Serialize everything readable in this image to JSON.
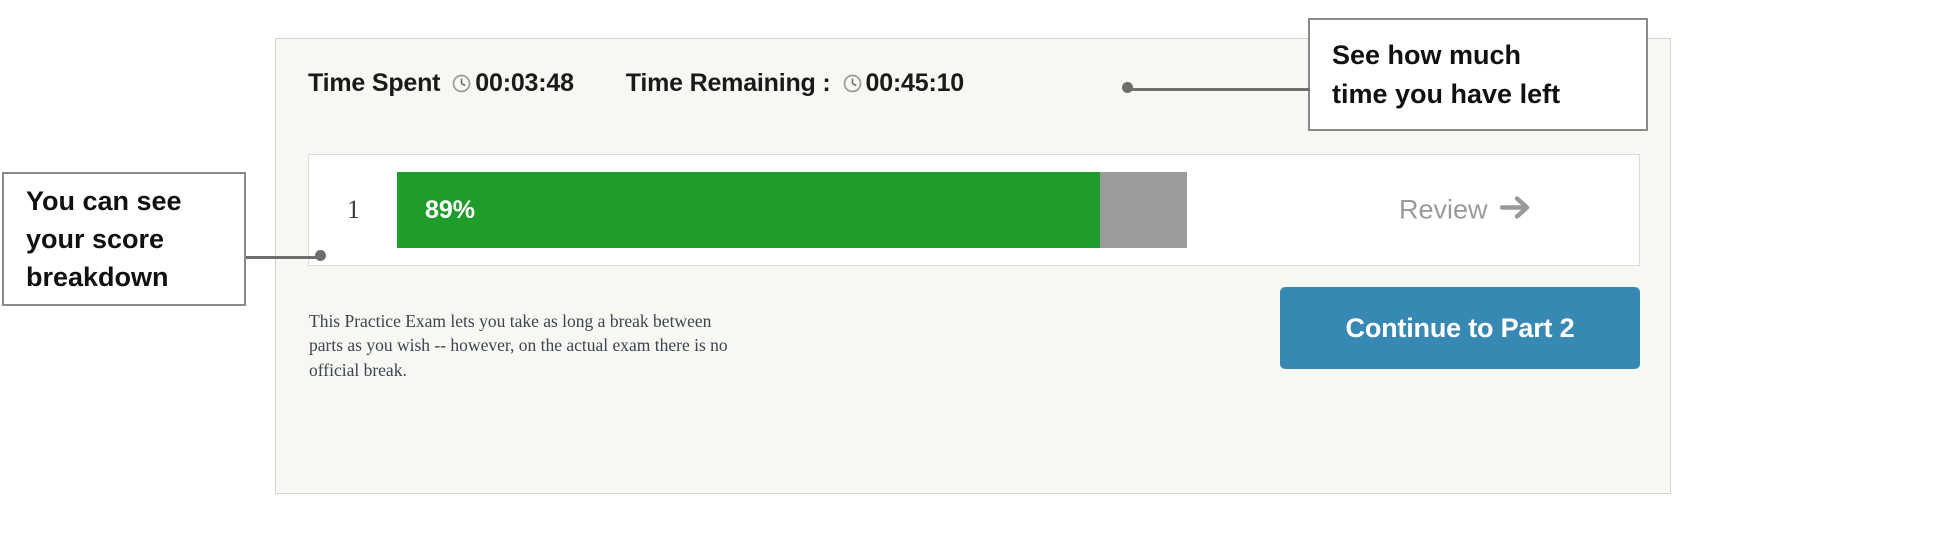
{
  "card": {
    "timer": {
      "spent_label": "Time Spent",
      "spent_value": "00:03:48",
      "remaining_label": "Time Remaining :",
      "remaining_value": "00:45:10",
      "clock_icon": "clock-icon"
    },
    "score_panel": {
      "part_number": "1",
      "percent_label": "89%",
      "percent_value": 89,
      "review_label": "Review",
      "review_icon": "arrow-right-icon",
      "fill_color": "#1f9d2b",
      "track_color": "#9b9b9b"
    },
    "note": "This Practice Exam lets you take as long a break between parts as you wish -- however, on the actual exam there is no official break.",
    "continue_label": "Continue to Part 2",
    "continue_color": "#3789b3"
  },
  "annotations": {
    "time_callout": {
      "line1": "See how much",
      "line2": "time you have left"
    },
    "score_callout": {
      "line1": "You can see",
      "line2": "your score",
      "line3": "breakdown"
    }
  }
}
